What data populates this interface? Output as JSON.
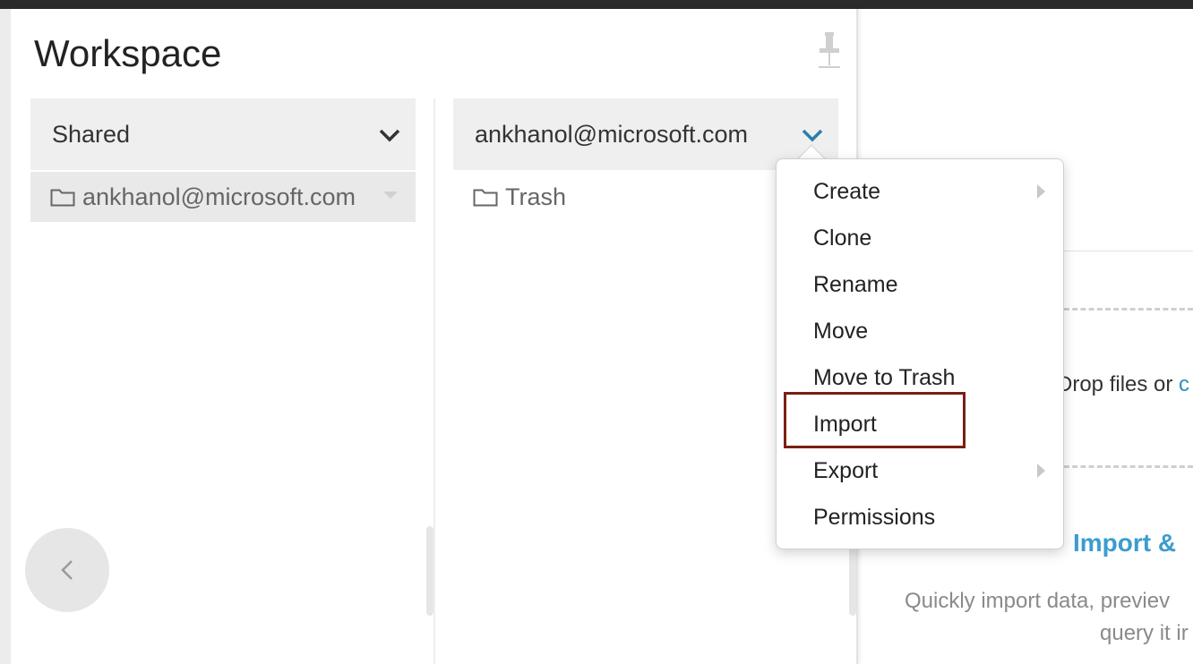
{
  "workspace": {
    "title": "Workspace"
  },
  "left_column": {
    "header_label": "Shared",
    "items": [
      {
        "label": "ankhanol@microsoft.com"
      }
    ]
  },
  "right_column": {
    "header_label": "ankhanol@microsoft.com",
    "items": [
      {
        "label": "Trash"
      }
    ]
  },
  "context_menu": {
    "items": [
      {
        "label": "Create",
        "has_submenu": true
      },
      {
        "label": "Clone",
        "has_submenu": false
      },
      {
        "label": "Rename",
        "has_submenu": false
      },
      {
        "label": "Move",
        "has_submenu": false
      },
      {
        "label": "Move to Trash",
        "has_submenu": false
      },
      {
        "label": "Import",
        "has_submenu": false,
        "highlighted": true
      },
      {
        "label": "Export",
        "has_submenu": true
      },
      {
        "label": "Permissions",
        "has_submenu": false
      }
    ]
  },
  "main": {
    "drop_text": "Drop files or",
    "drop_link": "c",
    "import_heading": "Import &",
    "import_desc_line1": "Quickly import data, previev",
    "import_desc_line2": "query it ir"
  },
  "colors": {
    "accent": "#3b9ccf",
    "highlight_border": "#7b1f12"
  }
}
